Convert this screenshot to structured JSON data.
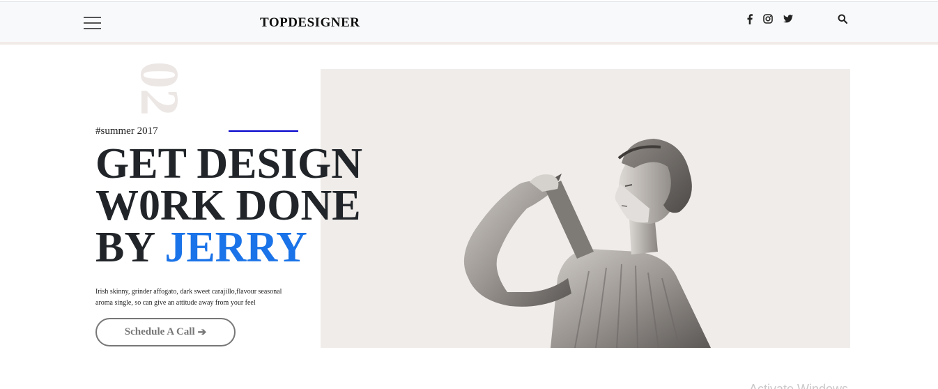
{
  "header": {
    "brand": "TOPDESIGNER",
    "icons": [
      "menu-icon",
      "facebook-icon",
      "instagram-icon",
      "twitter-icon",
      "search-icon"
    ]
  },
  "hero": {
    "slide_number": "02",
    "tag": "#summer 2017",
    "title_line1": "GET DESIGN",
    "title_line2": "W0RK DONE",
    "title_line3_prefix": "BY ",
    "title_line3_accent": "JERRY",
    "description": "Irish skinny, grinder affogato, dark sweet carajillo,flavour seasonal aroma single, so can give an attitude away from your feel",
    "cta_label": "Schedule A Call",
    "cta_icon": "arrow-right-icon"
  },
  "watermark": "Activate Windows",
  "colors": {
    "accent": "#1a73e8",
    "tag_line": "#0000cc",
    "image_bg": "#f0ecea",
    "text": "#212529"
  }
}
